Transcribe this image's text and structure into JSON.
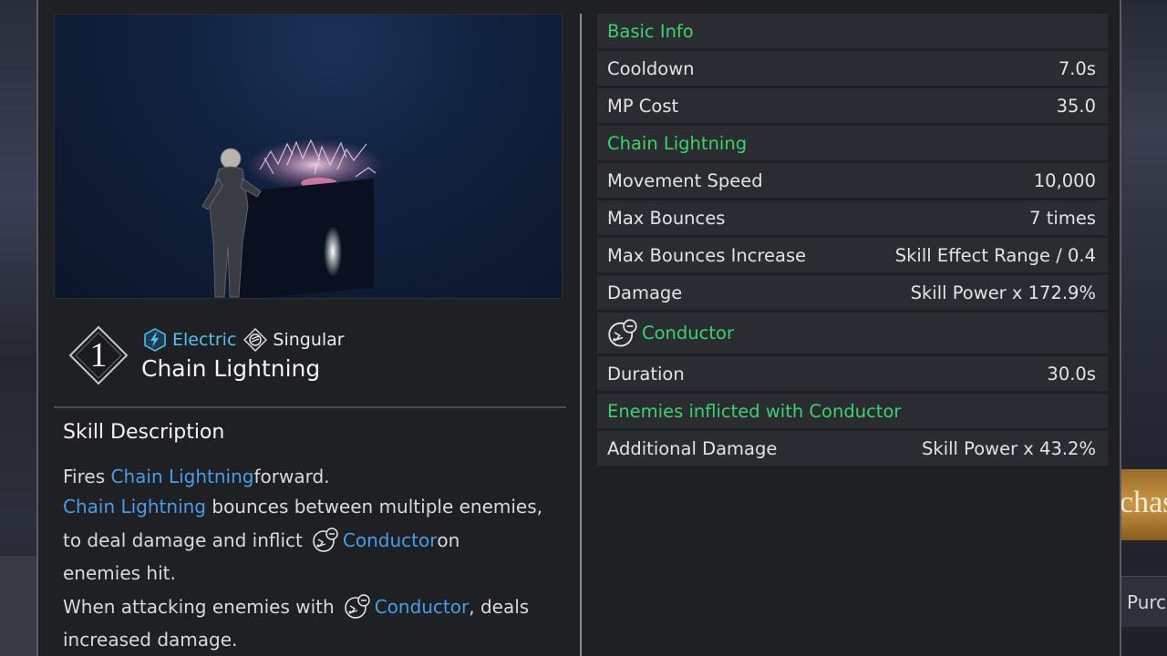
{
  "skill": {
    "rank": "1",
    "name": "Chain Lightning",
    "tags": [
      {
        "label": "Electric",
        "icon": "electric-icon",
        "color": "#56c1ef"
      },
      {
        "label": "Singular",
        "icon": "singular-icon",
        "color": "#ececec"
      }
    ]
  },
  "description": {
    "title": "Skill Description",
    "lines": [
      {
        "t1": "Fires ",
        "h1": "Chain Lightning",
        "t2": " forward."
      },
      {
        "h1": "Chain Lightning",
        "t1": " bounces between multiple enemies,"
      },
      {
        "t1": "to deal damage and inflict",
        "icon": "conductor-icon",
        "h1": "Conductor",
        "t2": " on"
      },
      {
        "t1": "enemies hit."
      },
      {
        "t1": "When attacking enemies with",
        "icon": "conductor-icon",
        "h1": "Conductor",
        "t2": ", deals"
      },
      {
        "t1": "increased damage."
      }
    ]
  },
  "stats": {
    "basic_info": "Basic Info",
    "cooldown": {
      "label": "Cooldown",
      "value": "7.0s"
    },
    "mp_cost": {
      "label": "MP Cost",
      "value": "35.0"
    },
    "chain_lightning": "Chain Lightning",
    "movement_speed": {
      "label": "Movement Speed",
      "value": "10,000"
    },
    "max_bounces": {
      "label": "Max Bounces",
      "value": "7 times"
    },
    "max_bounces_increase": {
      "label": "Max Bounces Increase",
      "value": "Skill Effect Range / 0.4"
    },
    "damage": {
      "label": "Damage",
      "value": "Skill Power x 172.9%"
    },
    "conductor": "Conductor",
    "duration": {
      "label": "Duration",
      "value": "30.0s"
    },
    "enemies_conductor": "Enemies inflicted with Conductor",
    "additional_damage": {
      "label": "Additional Damage",
      "value": "Skill Power x 43.2%"
    }
  },
  "background": {
    "purchase_gold_text": "chas",
    "purchase_alt_text": "Purc"
  },
  "colors": {
    "section_green": "#3dd26a",
    "highlight_blue": "#4d9be6",
    "electric_blue": "#56c1ef",
    "panel_bg": "#1e2024",
    "row_bg": "#2a2c31"
  }
}
